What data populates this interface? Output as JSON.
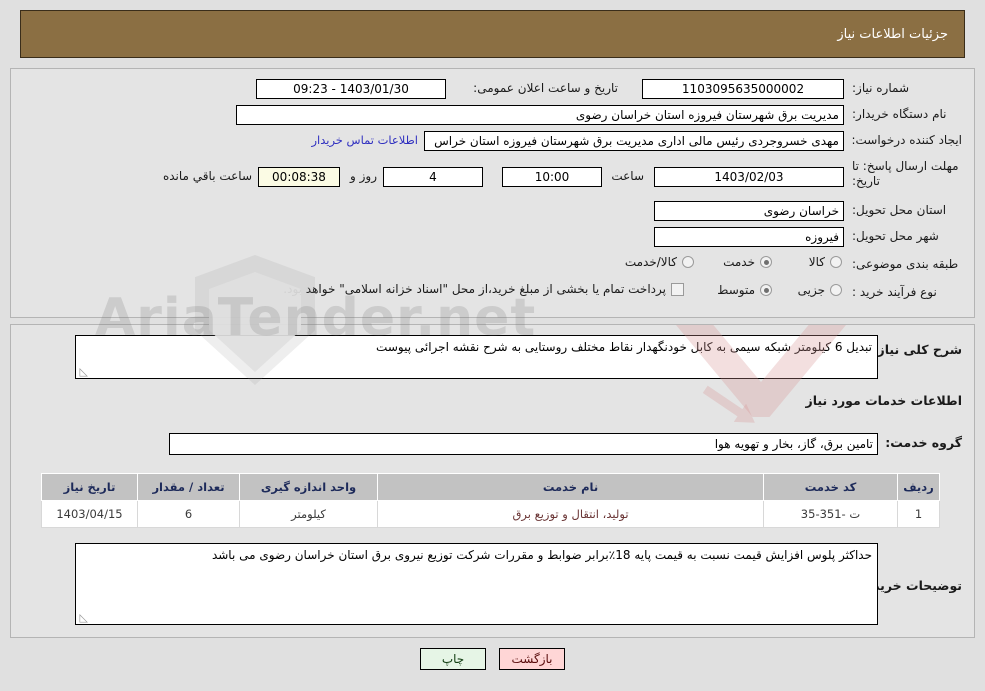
{
  "header": {
    "title": "جزئیات اطلاعات نیاز"
  },
  "top_form": {
    "need_number_label": "شماره نیاز:",
    "need_number_value": "1103095635000002",
    "announce_label": "تاریخ و ساعت اعلان عمومی:",
    "announce_value": "1403/01/30 - 09:23",
    "buyer_org_label": "نام دستگاه خریدار:",
    "buyer_org_value": "مدیریت برق شهرستان فیروزه استان خراسان رضوی",
    "creator_label": "ایجاد کننده درخواست:",
    "creator_value": "مهدی خسروجردی رئیس مالی اداری مدیریت برق شهرستان فیروزه استان خراس",
    "contact_link": "اطلاعات تماس خریدار",
    "deadline_label": "مهلت ارسال پاسخ: تا تاریخ:",
    "deadline_date": "1403/02/03",
    "hour_label": "ساعت",
    "hour_value": "10:00",
    "days_value": "4",
    "days_label": "روز و",
    "timer_value": "00:08:38",
    "timer_label": "ساعت باقي مانده",
    "province_label": "استان محل تحویل:",
    "province_value": "خراسان رضوی",
    "city_label": "شهر محل تحویل:",
    "city_value": "فیروزه",
    "category_label": "طبقه بندی موضوعی:",
    "category_options": [
      {
        "label": "کالا",
        "selected": false
      },
      {
        "label": "خدمت",
        "selected": true
      },
      {
        "label": "کالا/خدمت",
        "selected": false
      }
    ],
    "process_label": "نوع فرآیند خرید :",
    "process_options": [
      {
        "label": "جزیی",
        "selected": false
      },
      {
        "label": "متوسط",
        "selected": true
      }
    ],
    "treasury_checkbox_label": "پرداخت تمام یا بخشی از مبلغ خرید،از محل \"اسناد خزانه اسلامی\" خواهد بود.",
    "treasury_checked": false
  },
  "mid": {
    "summary_label": "شرح کلی نیاز:",
    "summary_value": "تبدیل 6 کیلومتر شبکه سیمی به کابل خودنگهدار نقاط مختلف روستایی به شرح نقشه اجرائی پیوست",
    "services_section_title": "اطلاعات خدمات مورد نیاز",
    "service_group_label": "گروه خدمت:",
    "service_group_value": "تامین برق، گاز، بخار و تهویه هوا",
    "notes_label": "توضیحات خریدار:",
    "notes_value": "حداکثر پلوس افزایش قیمت نسبت به قیمت پایه 18٪برابر ضوابط و مقررات شرکت توزیع نیروی برق استان خراسان رضوی می باشد"
  },
  "table": {
    "columns": [
      "ردیف",
      "کد خدمت",
      "نام خدمت",
      "واحد اندازه گیری",
      "تعداد / مقدار",
      "تاریخ نیاز"
    ],
    "rows": [
      {
        "row_no": "1",
        "service_code": "ت -351-35",
        "service_name": "تولید، انتقال و توزیع برق",
        "unit": "کیلومتر",
        "quantity": "6",
        "need_date": "1403/04/15"
      }
    ]
  },
  "footer": {
    "print_label": "چاپ",
    "back_label": "بازگشت"
  },
  "watermark": {
    "text": "AriaTender.net"
  }
}
